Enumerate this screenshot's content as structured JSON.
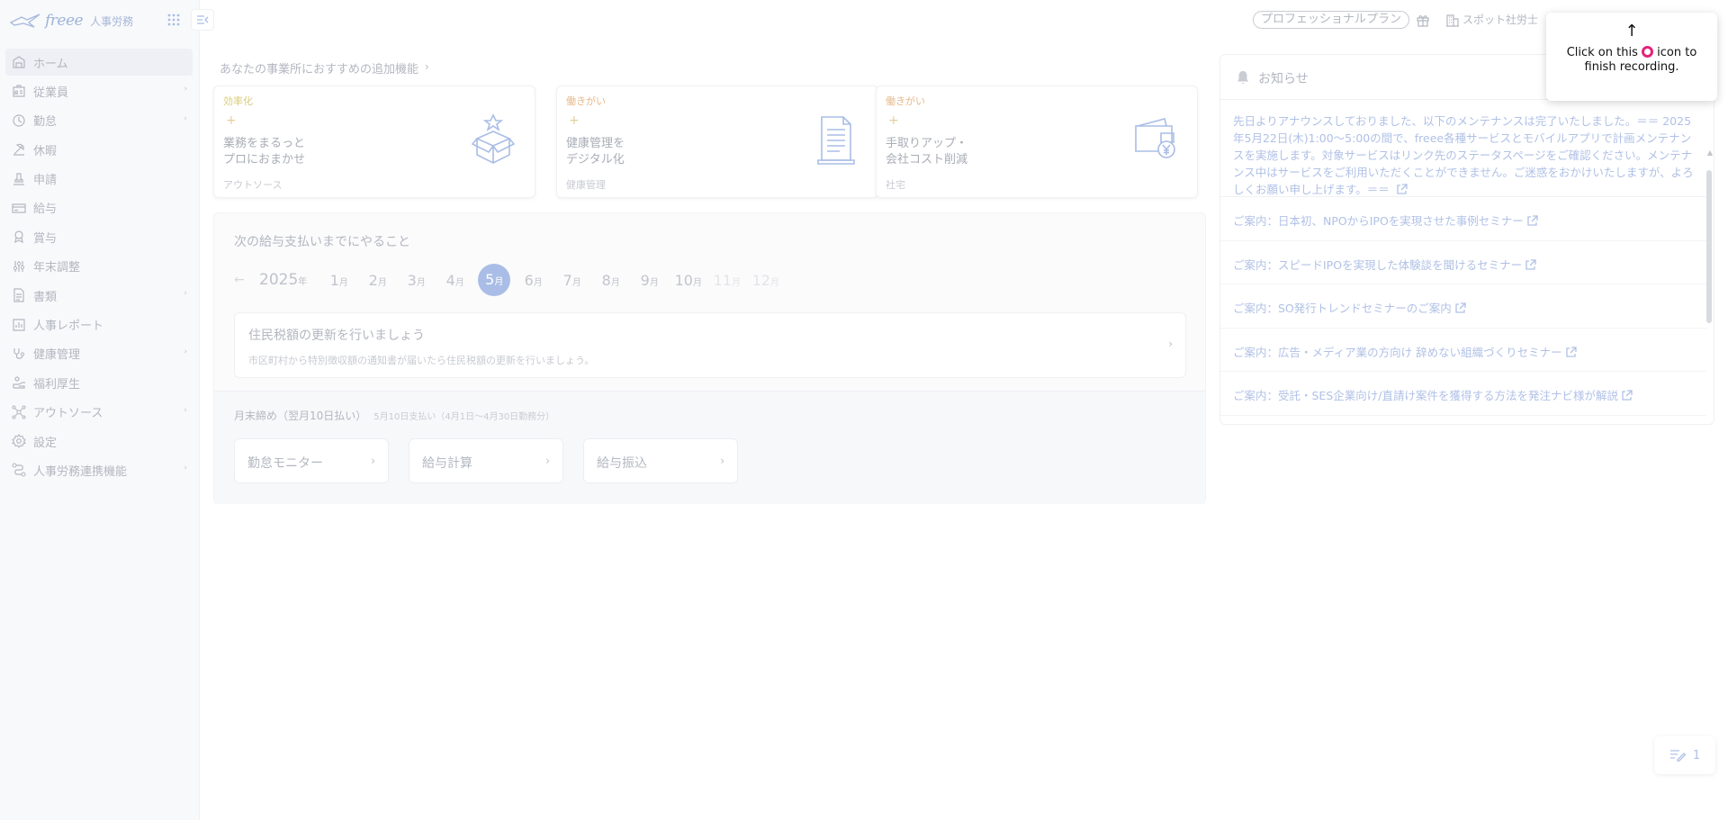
{
  "app": {
    "logo_text": "freee",
    "logo_sub": "人事労務"
  },
  "sidebar": {
    "items": [
      {
        "label": "ホーム",
        "icon": "home-icon",
        "active": true,
        "chevron": false
      },
      {
        "label": "従業員",
        "icon": "employee-icon",
        "chevron": true
      },
      {
        "label": "勤怠",
        "icon": "clock-icon",
        "chevron": true
      },
      {
        "label": "休暇",
        "icon": "vacation-icon",
        "chevron": false
      },
      {
        "label": "申請",
        "icon": "stamp-icon",
        "chevron": false
      },
      {
        "label": "給与",
        "icon": "card-icon",
        "chevron": false
      },
      {
        "label": "賞与",
        "icon": "bonus-icon",
        "chevron": false
      },
      {
        "label": "年末調整",
        "icon": "adjust-icon",
        "chevron": false
      },
      {
        "label": "書類",
        "icon": "document-icon",
        "chevron": true
      },
      {
        "label": "人事レポート",
        "icon": "report-icon",
        "chevron": false
      },
      {
        "label": "健康管理",
        "icon": "stethoscope-icon",
        "chevron": true
      },
      {
        "label": "福利厚生",
        "icon": "benefit-icon",
        "chevron": false
      },
      {
        "label": "アウトソース",
        "icon": "network-icon",
        "chevron": true
      },
      {
        "label": "設定",
        "icon": "gear-icon",
        "chevron": false
      },
      {
        "label": "人事労務連携機能",
        "icon": "link-icon",
        "chevron": true
      }
    ]
  },
  "header": {
    "plan": "プロフェッショナルプラン",
    "org_name": "スポット社労士"
  },
  "recommend": {
    "title": "あなたの事業所におすすめの追加機能",
    "cards": [
      {
        "tag": "効率化",
        "tag_color": "#d9cc7a",
        "headline": "業務をまるっと\nプロにおまかせ",
        "foot": "アウトソース",
        "illus": "box-icon"
      },
      {
        "tag": "働きがい",
        "tag_color": "#e7b98a",
        "headline": "健康管理を\nデジタル化",
        "foot": "健康管理",
        "illus": "clipboard-icon"
      },
      {
        "tag": "働きがい",
        "tag_color": "#e7b98a",
        "headline": "手取りアップ・\n会社コスト削減",
        "foot": "社宅",
        "illus": "wallet-icon"
      }
    ]
  },
  "todo": {
    "title": "次の給与支払いまでにやること",
    "year": "2025",
    "year_suffix": "年",
    "month_suffix": "月",
    "months": [
      "1",
      "2",
      "3",
      "4",
      "5",
      "6",
      "7",
      "8",
      "9",
      "10",
      "11",
      "12"
    ],
    "selected_month": "5",
    "task": {
      "title": "住民税額の更新を行いましょう",
      "sub": "市区町村から特別徴収額の通知書が届いたら住民税額の更新を行いましょう。"
    },
    "closing": {
      "title": "月末締め（翌月10日払い）",
      "sub": "5月10日支払い（4月1日〜4月30日勤務分）",
      "steps": [
        "勤怠モニター",
        "給与計算",
        "給与振込"
      ]
    }
  },
  "notice": {
    "title": "お知らせ",
    "main": "先日よりアナウンスしておりました、以下のメンテナンスは完了いたしました。＝＝ 2025年5月22日(木)1:00～5:00の間で、freee各種サービスとモバイルアプリで計画メンテナンスを実施します。対象サービスはリンク先のステータスページをご確認ください。メンテナンス中はサービスをご利用いただくことができません。ご迷惑をおかけいたしますが、よろしくお願い申し上げます。＝＝",
    "items": [
      "ご案内：日本初、NPOからIPOを実現させた事例セミナー",
      "ご案内：スピードIPOを実現した体験談を聞けるセミナー",
      "ご案内：SO発行トレンドセミナーのご案内",
      "ご案内：広告・メディア業の方向け 辞めない組織づくりセミナー",
      "ご案内：受託・SES企業向け/直請け案件を獲得する方法を発注ナビ様が解説"
    ]
  },
  "tooltip": {
    "arrow": "↑",
    "text_before": "Click on this",
    "text_after": "icon to finish recording."
  },
  "widget": {
    "count": "1"
  }
}
